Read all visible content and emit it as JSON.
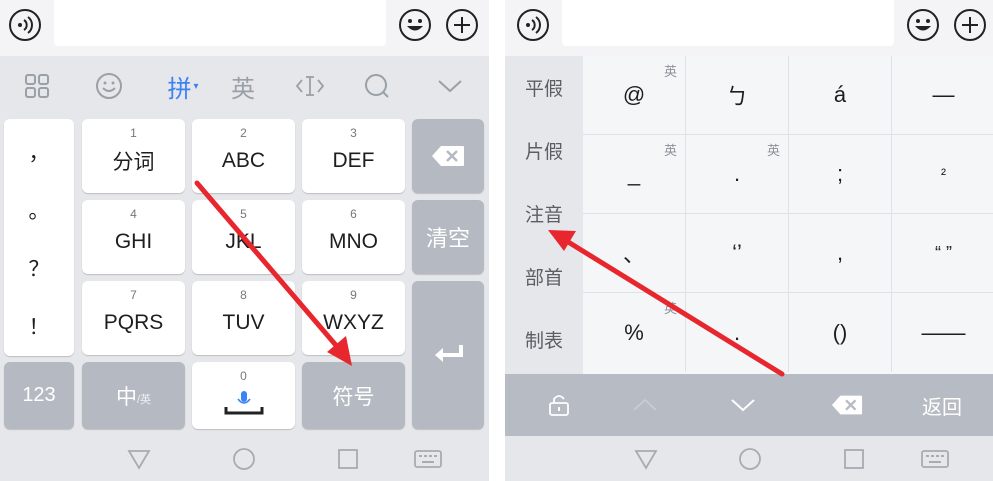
{
  "left": {
    "toolbar": {
      "pinyin_label": "拼",
      "english_label": "英"
    },
    "punct_keys": [
      "，",
      "。",
      "？",
      "！"
    ],
    "keys": [
      {
        "num": "1",
        "label": "分词"
      },
      {
        "num": "2",
        "label": "ABC"
      },
      {
        "num": "3",
        "label": "DEF"
      },
      {
        "num": "4",
        "label": "GHI"
      },
      {
        "num": "5",
        "label": "JKL"
      },
      {
        "num": "6",
        "label": "MNO"
      },
      {
        "num": "7",
        "label": "PQRS"
      },
      {
        "num": "8",
        "label": "TUV"
      },
      {
        "num": "9",
        "label": "WXYZ"
      }
    ],
    "clear_label": "清空",
    "num_mode_label": "123",
    "cn_label": "中",
    "en_small_label": "/英",
    "space_num": "0",
    "symbol_label": "符号"
  },
  "right": {
    "categories": [
      "平假",
      "片假",
      "注音",
      "部首",
      "制表"
    ],
    "cells": [
      {
        "text": "@",
        "tag": "英"
      },
      {
        "text": "ㄅ",
        "tag": ""
      },
      {
        "text": "á",
        "tag": ""
      },
      {
        "text": "—",
        "tag": ""
      },
      {
        "text": "_",
        "tag": "英"
      },
      {
        "text": ".",
        "tag": "英"
      },
      {
        "text": ";",
        "tag": ""
      },
      {
        "text": "²",
        "tag": ""
      },
      {
        "text": "、",
        "tag": ""
      },
      {
        "text": "‘’",
        "tag": ""
      },
      {
        "text": ",",
        "tag": ""
      },
      {
        "text": "“ ”",
        "tag": ""
      },
      {
        "text": "%",
        "tag": "英"
      },
      {
        "text": ".",
        "tag": ""
      },
      {
        "text": "()",
        "tag": ""
      },
      {
        "text": "——",
        "tag": ""
      }
    ],
    "back_label": "返回"
  },
  "colors": {
    "accent": "#3b82f6",
    "annotation_arrow": "#e8262e"
  }
}
